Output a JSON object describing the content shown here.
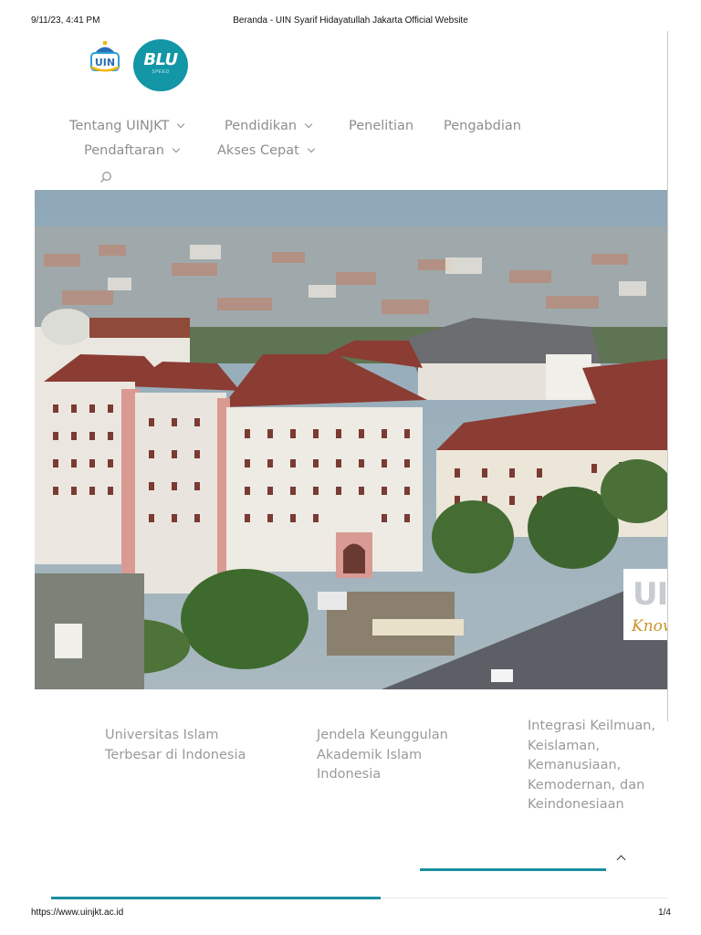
{
  "print_header": {
    "datetime": "9/11/23, 4:41 PM",
    "title": "Beranda - UIN Syarif Hidayatullah Jakarta Official Website"
  },
  "logos": {
    "uin_text": "UIN",
    "blu_text": "BLU",
    "blu_subtext": "SPEED"
  },
  "nav": {
    "items": [
      {
        "label": "Tentang UINJKT",
        "dropdown": true
      },
      {
        "label": "Pendidikan",
        "dropdown": true
      },
      {
        "label": "Penelitian",
        "dropdown": false
      },
      {
        "label": "Pengabdian",
        "dropdown": false
      },
      {
        "label": "Pendaftaran",
        "dropdown": true
      },
      {
        "label": "Akses Cepat",
        "dropdown": true
      }
    ],
    "search_icon": "search-icon"
  },
  "hero": {
    "badge_top": "UII",
    "badge_bottom": "Know"
  },
  "features": [
    {
      "text": "Universitas Islam Terbesar di Indonesia"
    },
    {
      "text": "Jendela Keunggulan Akademik Islam Indonesia"
    },
    {
      "text": "Integrasi Keilmuan, Keislaman, Kemanusiaan, Kemodernan, dan Keindonesiaan"
    }
  ],
  "colors": {
    "accent": "#1a8fa0",
    "nav_text": "#8e8e8e",
    "blu_logo": "#1396a6"
  },
  "print_footer": {
    "url": "https://www.uinjkt.ac.id",
    "page": "1/4"
  }
}
